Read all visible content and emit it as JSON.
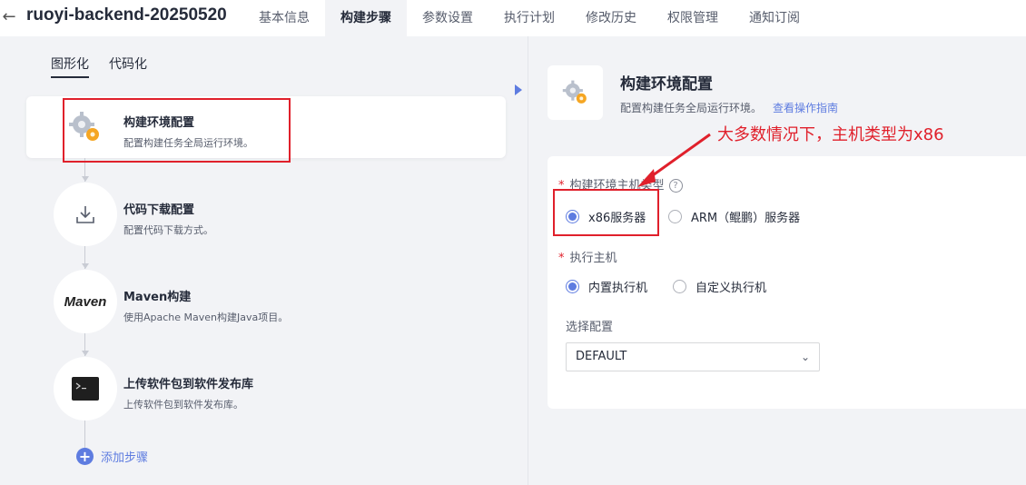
{
  "header": {
    "back_icon": "arrow-left-icon",
    "title": "ruoyi-backend-20250520",
    "tabs": [
      {
        "label": "基本信息",
        "active": false
      },
      {
        "label": "构建步骤",
        "active": true
      },
      {
        "label": "参数设置",
        "active": false
      },
      {
        "label": "执行计划",
        "active": false
      },
      {
        "label": "修改历史",
        "active": false
      },
      {
        "label": "权限管理",
        "active": false
      },
      {
        "label": "通知订阅",
        "active": false
      }
    ]
  },
  "left": {
    "subtabs": [
      {
        "label": "图形化",
        "active": true
      },
      {
        "label": "代码化",
        "active": false
      }
    ],
    "steps": [
      {
        "name": "构建环境配置",
        "desc": "配置构建任务全局运行环境。",
        "icon": "gear-icon",
        "selected": true
      },
      {
        "name": "代码下载配置",
        "desc": "配置代码下载方式。",
        "icon": "download-icon",
        "selected": false
      },
      {
        "name": "Maven构建",
        "desc": "使用Apache Maven构建Java项目。",
        "icon": "maven-logo-icon",
        "icon_text": "Maven",
        "selected": false
      },
      {
        "name": "上传软件包到软件发布库",
        "desc": "上传软件包到软件发布库。",
        "icon": "terminal-icon",
        "selected": false
      }
    ],
    "add_step_label": "添加步骤"
  },
  "panel": {
    "title": "构建环境配置",
    "desc": "配置构建任务全局运行环境。",
    "link": "查看操作指南",
    "host_type": {
      "label": "构建环境主机类型",
      "required": true,
      "help_icon": "question-circle-icon",
      "options": [
        {
          "label": "x86服务器",
          "selected": true
        },
        {
          "label": "ARM（鲲鹏）服务器",
          "selected": false
        }
      ]
    },
    "executor": {
      "label": "执行主机",
      "required": true,
      "options": [
        {
          "label": "内置执行机",
          "selected": true
        },
        {
          "label": "自定义执行机",
          "selected": false
        }
      ]
    },
    "config": {
      "label": "选择配置",
      "value": "DEFAULT"
    }
  },
  "annotation": {
    "text": "大多数情况下，主机类型为x86",
    "color": "#e0202b"
  },
  "colors": {
    "accent": "#5e7ce0",
    "annotation_red": "#e0202b",
    "background": "#f2f3f6"
  }
}
